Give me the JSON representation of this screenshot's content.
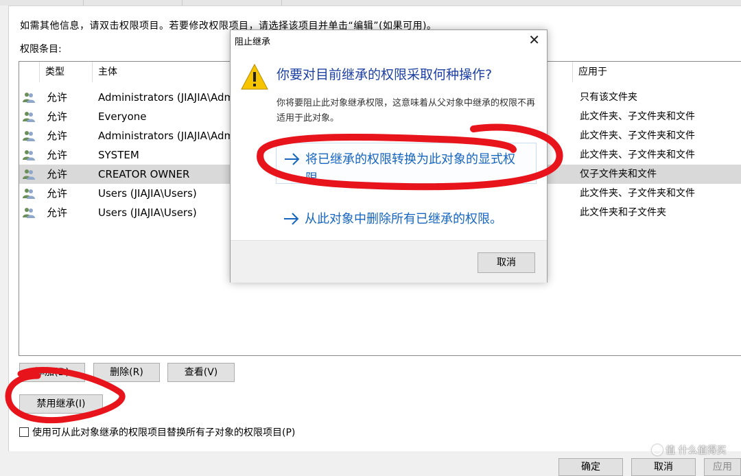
{
  "info_text": "如需其他信息，请双击权限项目。若要修改权限项目，请选择该项目并单击“编辑”(如果可用)。",
  "perm_label": "权限条目:",
  "table": {
    "columns": [
      "类型",
      "主体",
      "应用于"
    ],
    "rows": [
      {
        "type": "允许",
        "principal": "Administrators (JIAJIA\\Administrators)",
        "applies": "只有该文件夹"
      },
      {
        "type": "允许",
        "principal": "Everyone",
        "applies": "此文件夹、子文件夹和文件"
      },
      {
        "type": "允许",
        "principal": "Administrators (JIAJIA\\Administrators)",
        "applies": "此文件夹、子文件夹和文件"
      },
      {
        "type": "允许",
        "principal": "SYSTEM",
        "applies": "此文件夹、子文件夹和文件"
      },
      {
        "type": "允许",
        "principal": "CREATOR OWNER",
        "applies": "仅子文件夹和文件"
      },
      {
        "type": "允许",
        "principal": "Users (JIAJIA\\Users)",
        "applies": "此文件夹、子文件夹和文件"
      },
      {
        "type": "允许",
        "principal": "Users (JIAJIA\\Users)",
        "applies": "此文件夹和子文件夹"
      }
    ]
  },
  "buttons": {
    "add": "添加(D)",
    "remove": "删除(R)",
    "view": "查看(V)",
    "disable_inheritance": "禁用继承(I)",
    "ok": "确定",
    "cancel": "取消",
    "apply": "应用"
  },
  "replace_checkbox": "使用可从此对象继承的权限项目替换所有子对象的权限项目(P)",
  "dialog": {
    "title": "阻止继承",
    "heading": "你要对目前继承的权限采取何种操作?",
    "description": "你将要阻止此对象继承权限，这意味着从父对象中继承的权限不再适用于此对象。",
    "option_convert": "将已继承的权限转换为此对象的显式权限。",
    "option_remove": "从此对象中删除所有已继承的权限。",
    "cancel": "取消"
  },
  "watermark": "值 什么值得买",
  "colors": {
    "dialog_heading": "#1c3fa3",
    "command_link": "#1565c0",
    "annotation_red": "#e8141c",
    "selected_row": "#d9d9d9"
  }
}
